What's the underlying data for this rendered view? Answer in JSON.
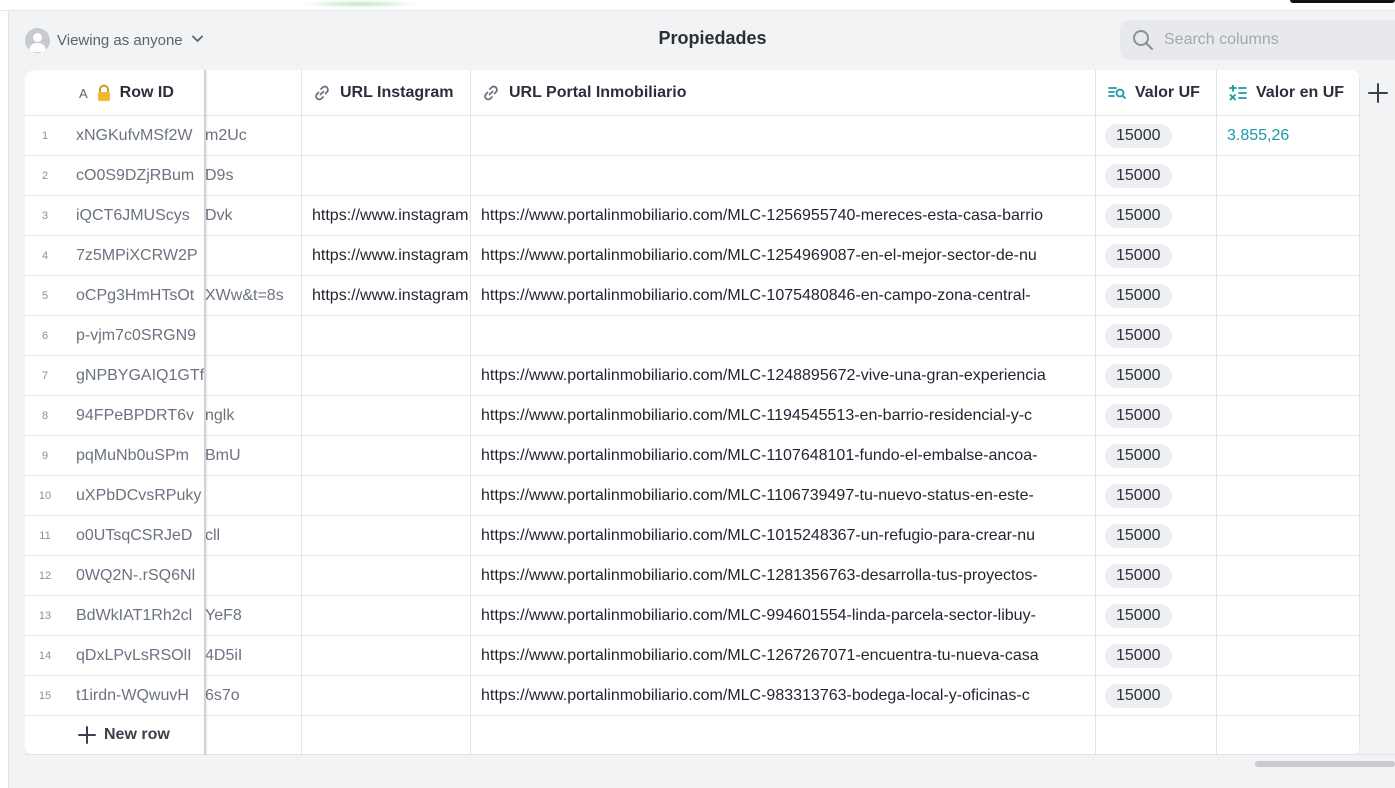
{
  "header": {
    "viewing_label": "Viewing as anyone",
    "title": "Propiedades",
    "search_placeholder": "Search columns"
  },
  "columns": {
    "row_id": "Row ID",
    "row_id_type": "A",
    "url_instagram": "URL Instagram",
    "url_portal": "URL Portal Inmobiliario",
    "valor_uf": "Valor UF",
    "valor_en_uf": "Valor en UF"
  },
  "rows": [
    {
      "n": "1",
      "id_a": "xNGKufvMSf2W",
      "id_b": "m2Uc",
      "ig": "",
      "portal": "",
      "uf": "15000",
      "en_uf": "3.855,26"
    },
    {
      "n": "2",
      "id_a": "cO0S9DZjRBum",
      "id_b": "D9s",
      "ig": "",
      "portal": "",
      "uf": "15000",
      "en_uf": ""
    },
    {
      "n": "3",
      "id_a": "iQCT6JMUScys",
      "id_b": "Dvk",
      "ig": "https://www.instagram.com/",
      "portal": "https://www.portalinmobiliario.com/MLC-1256955740-mereces-esta-casa-barrio",
      "uf": "15000",
      "en_uf": ""
    },
    {
      "n": "4",
      "id_a": "7z5MPiXCRW2P",
      "id_b": "",
      "ig": "https://www.instagram.com/",
      "portal": "https://www.portalinmobiliario.com/MLC-1254969087-en-el-mejor-sector-de-nu",
      "uf": "15000",
      "en_uf": ""
    },
    {
      "n": "5",
      "id_a": "oCPg3HmHTsOt",
      "id_b": "XWw&t=8s",
      "ig": "https://www.instagram.com/",
      "portal": "https://www.portalinmobiliario.com/MLC-1075480846-en-campo-zona-central-",
      "uf": "15000",
      "en_uf": ""
    },
    {
      "n": "6",
      "id_a": "p-vjm7c0SRGN9",
      "id_b": "",
      "ig": "",
      "portal": "",
      "uf": "15000",
      "en_uf": ""
    },
    {
      "n": "7",
      "id_a": "gNPBYGAIQ1GTf",
      "id_b": "",
      "ig": "",
      "portal": "https://www.portalinmobiliario.com/MLC-1248895672-vive-una-gran-experiencia",
      "uf": "15000",
      "en_uf": ""
    },
    {
      "n": "8",
      "id_a": "94FPeBPDRT6v",
      "id_b": "nglk",
      "ig": "",
      "portal": "https://www.portalinmobiliario.com/MLC-1194545513-en-barrio-residencial-y-c",
      "uf": "15000",
      "en_uf": ""
    },
    {
      "n": "9",
      "id_a": "pqMuNb0uSPm",
      "id_b": "BmU",
      "ig": "",
      "portal": "https://www.portalinmobiliario.com/MLC-1107648101-fundo-el-embalse-ancoa-",
      "uf": "15000",
      "en_uf": ""
    },
    {
      "n": "10",
      "id_a": "uXPbDCvsRPuky",
      "id_b": "",
      "ig": "",
      "portal": "https://www.portalinmobiliario.com/MLC-1106739497-tu-nuevo-status-en-este-",
      "uf": "15000",
      "en_uf": ""
    },
    {
      "n": "11",
      "id_a": "o0UTsqCSRJeD",
      "id_b": "cll",
      "ig": "",
      "portal": "https://www.portalinmobiliario.com/MLC-1015248367-un-refugio-para-crear-nu",
      "uf": "15000",
      "en_uf": ""
    },
    {
      "n": "12",
      "id_a": "0WQ2N-.rSQ6Nl",
      "id_b": "",
      "ig": "",
      "portal": "https://www.portalinmobiliario.com/MLC-1281356763-desarrolla-tus-proyectos-",
      "uf": "15000",
      "en_uf": ""
    },
    {
      "n": "13",
      "id_a": "BdWkIAT1Rh2cl",
      "id_b": "YeF8",
      "ig": "",
      "portal": "https://www.portalinmobiliario.com/MLC-994601554-linda-parcela-sector-libuy-",
      "uf": "15000",
      "en_uf": ""
    },
    {
      "n": "14",
      "id_a": "qDxLPvLsRSOlI",
      "id_b": "4D5iI",
      "ig": "",
      "portal": "https://www.portalinmobiliario.com/MLC-1267267071-encuentra-tu-nueva-casa",
      "uf": "15000",
      "en_uf": ""
    },
    {
      "n": "15",
      "id_a": "t1irdn-WQwuvH",
      "id_b": "6s7o",
      "ig": "",
      "portal": "https://www.portalinmobiliario.com/MLC-983313763-bodega-local-y-oficinas-c",
      "uf": "15000",
      "en_uf": ""
    }
  ],
  "footer": {
    "new_row_label": "New row"
  },
  "icons": {
    "search": "search-icon",
    "lock": "lock-icon",
    "link": "link-icon",
    "lookup": "lookup-icon",
    "formula": "formula-icon",
    "add_column": "plus-icon",
    "new_row": "plus-icon"
  },
  "colors": {
    "accent": "#1a9aa8",
    "pill_bg": "#eceef1",
    "header_bg": "#f2f3f5"
  }
}
